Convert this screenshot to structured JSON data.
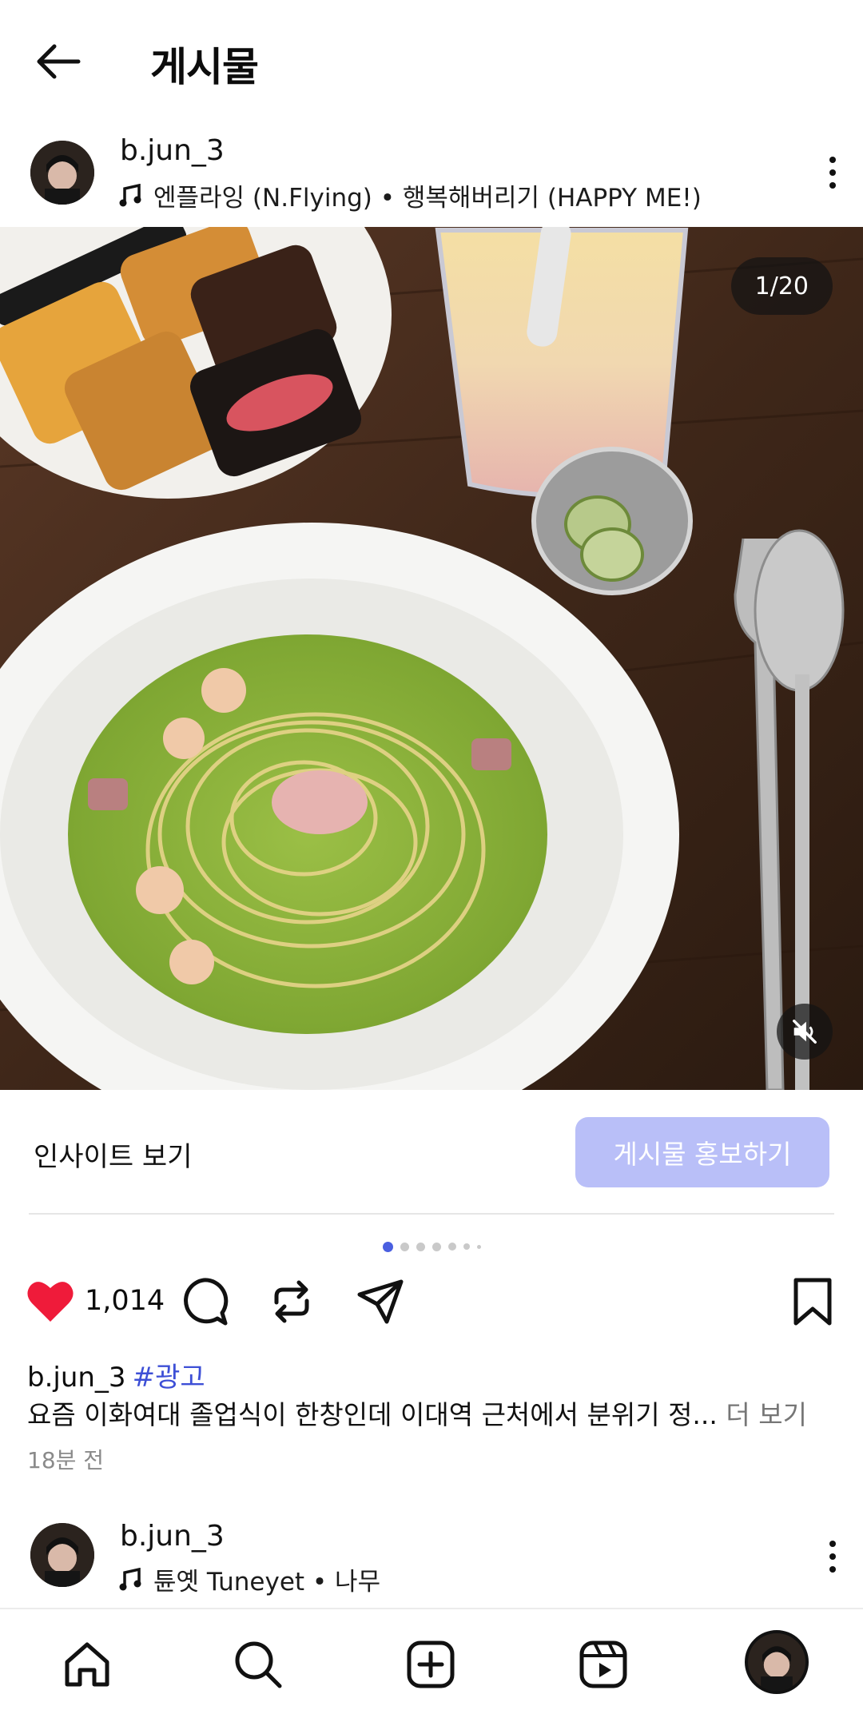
{
  "header": {
    "title": "게시물",
    "back_icon": "arrow-left-icon"
  },
  "post": {
    "username": "b.jun_3",
    "music": "엔플라잉 (N.Flying) • 행복해버리기 (HAPPY ME!)",
    "media_counter": "1/20",
    "insight_label": "인사이트 보기",
    "promote_label": "게시물 홍보하기",
    "carousel_dots": 7,
    "carousel_active_index": 0,
    "liked": true,
    "like_count": "1,014",
    "caption_user": "b.jun_3",
    "caption_tag": "#광고",
    "caption_text": "요즘 이화여대 졸업식이 한창인데 이대역 근처에서 분위기 정...",
    "caption_more": " 더 보기",
    "time_ago": "18분 전"
  },
  "next_post": {
    "username": "b.jun_3",
    "music": "튠옛 Tuneyet • 나무"
  },
  "colors": {
    "like_red": "#ef1b3a",
    "promote_bg": "#b9bff8",
    "tag_blue": "#3d4fd6",
    "dot_active": "#4a5fe0"
  },
  "bottom_nav": [
    "home-icon",
    "search-icon",
    "create-icon",
    "reels-icon",
    "profile-avatar"
  ]
}
